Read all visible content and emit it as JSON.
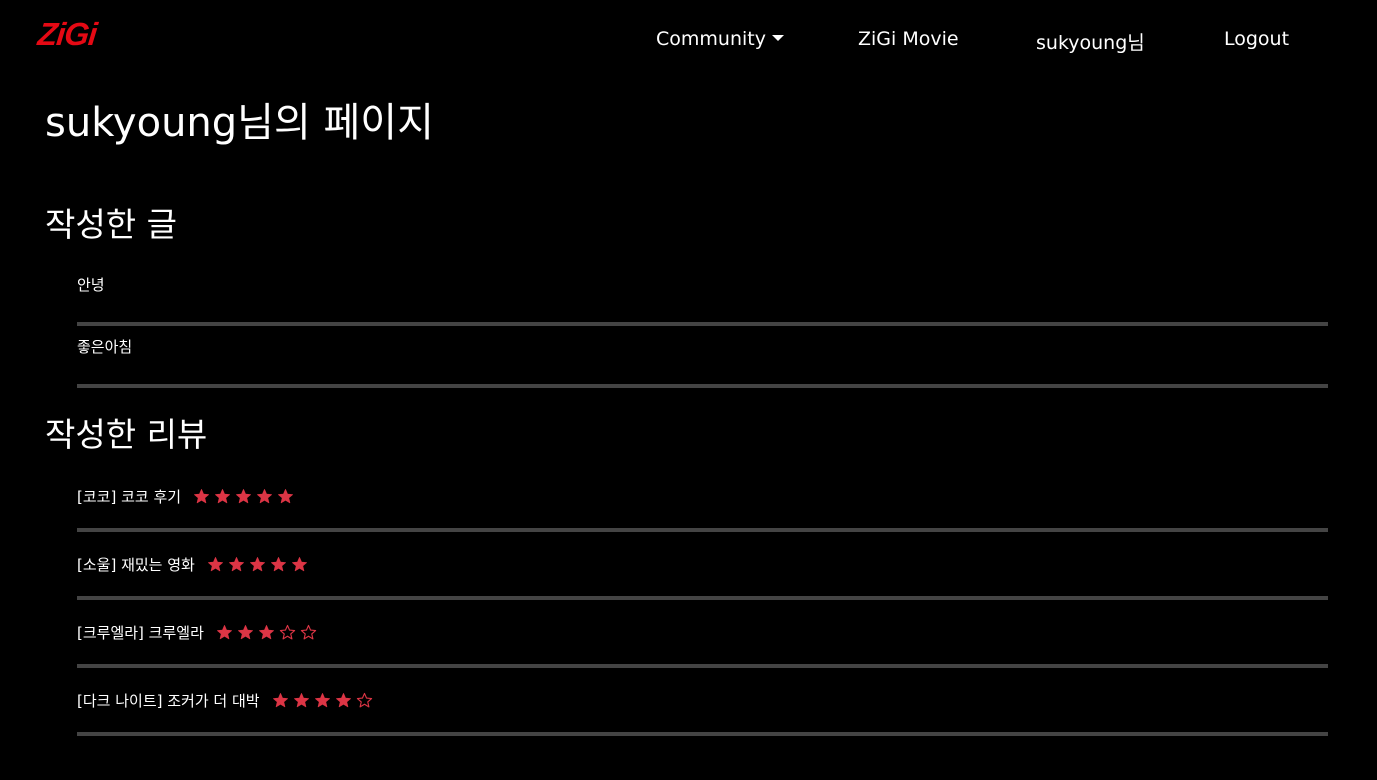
{
  "nav": {
    "logo": "ZiGi",
    "community_label": "Community",
    "movie_label": "ZiGi Movie",
    "user_label": "sukyoung님",
    "logout_label": "Logout"
  },
  "page": {
    "title": "sukyoung님의 페이지"
  },
  "posts": {
    "heading": "작성한 글",
    "items": [
      {
        "title": "안녕"
      },
      {
        "title": "좋은아침"
      }
    ]
  },
  "reviews": {
    "heading": "작성한 리뷰",
    "star_color": "#dc3545",
    "max_rating": 5,
    "items": [
      {
        "text": "[코코] 코코 후기",
        "rating": 5
      },
      {
        "text": "[소울] 재밌는 영화",
        "rating": 5
      },
      {
        "text": "[크루엘라] 크루엘라",
        "rating": 3
      },
      {
        "text": "[다크 나이트] 조커가 더 대박",
        "rating": 4
      }
    ]
  }
}
